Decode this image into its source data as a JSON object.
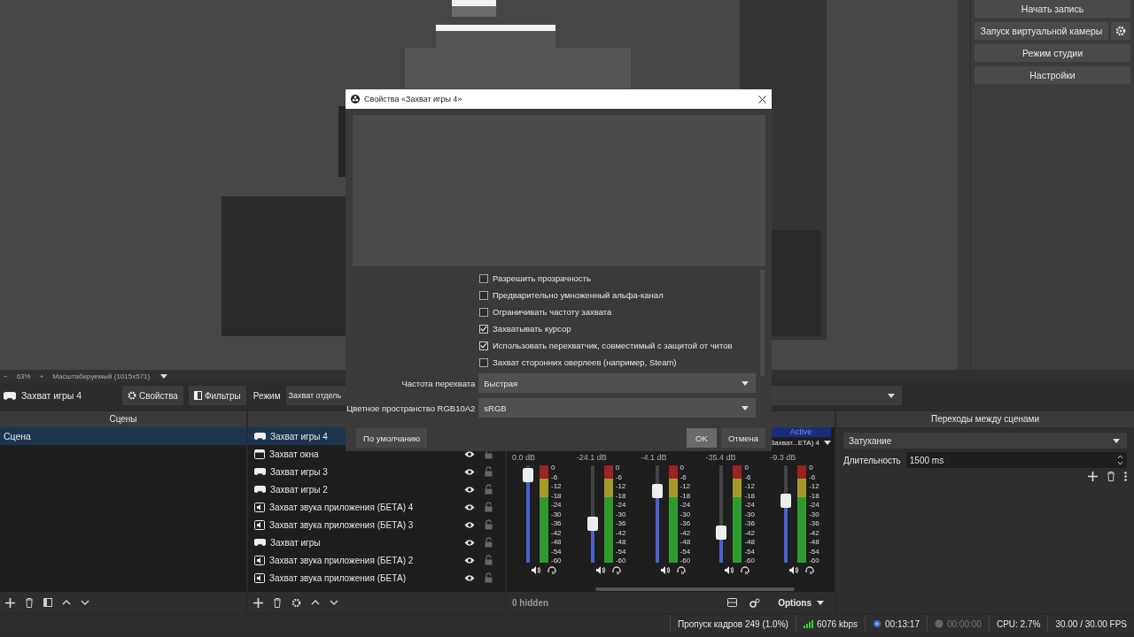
{
  "controls": [
    "Начать запись",
    "Запуск виртуальной камеры",
    "Режим студии",
    "Настройки"
  ],
  "zoom_bar": {
    "minus": "−",
    "zoom": "63%",
    "plus": "+",
    "mode": "Масштабируемый (1015x571)"
  },
  "source_toolbar": {
    "source": "Захват игры 4",
    "properties": "Свойства",
    "filters": "Фильтры",
    "mode_label": "Режим",
    "mode_value": "Захват отдель"
  },
  "scenes": {
    "title": "Сцены",
    "items": [
      {
        "name": "Сцена",
        "selected": true
      }
    ]
  },
  "sources": {
    "items": [
      {
        "name": "Захват игры 4",
        "kind": "game",
        "selected": true
      },
      {
        "name": "Захват окна",
        "kind": "window",
        "selected": false,
        "visible": true,
        "locked": false
      },
      {
        "name": "Захват игры 3",
        "kind": "game",
        "selected": false,
        "visible": true,
        "locked": false
      },
      {
        "name": "Захват игры 2",
        "kind": "game",
        "selected": false,
        "visible": true,
        "locked": false
      },
      {
        "name": "Захват звука приложения (БЕТА) 4",
        "kind": "audio",
        "selected": false,
        "visible": true,
        "locked": false
      },
      {
        "name": "Захват звука приложения (БЕТА) 3",
        "kind": "audio",
        "selected": false,
        "visible": true,
        "locked": false
      },
      {
        "name": "Захват игры",
        "kind": "game",
        "selected": false,
        "visible": true,
        "locked": false
      },
      {
        "name": "Захват звука приложения (БЕТА) 2",
        "kind": "audio",
        "selected": false,
        "visible": true,
        "locked": false
      },
      {
        "name": "Захват звука приложения (БЕТА)",
        "kind": "audio",
        "selected": false,
        "visible": true,
        "locked": false
      }
    ]
  },
  "mixer": {
    "active_badge": "Active",
    "last_name": "Захват...ETA) 4",
    "hidden": "0 hidden",
    "options": "Options",
    "channels": [
      {
        "reading": "0.0 dB",
        "level": 0.97,
        "scale": [
          "0",
          "-6",
          "-12",
          "-18",
          "-24",
          "-30",
          "-36",
          "-42",
          "-48",
          "-54",
          "-60"
        ]
      },
      {
        "reading": "-24.1 dB",
        "level": 0.38,
        "scale": [
          "0",
          "-6",
          "-12",
          "-18",
          "-24",
          "-30",
          "-36",
          "-42",
          "-48",
          "-54",
          "-60"
        ]
      },
      {
        "reading": "-4.1 dB",
        "level": 0.78,
        "scale": [
          "0",
          "-6",
          "-12",
          "-18",
          "-24",
          "-30",
          "-36",
          "-42",
          "-48",
          "-54",
          "-60"
        ]
      },
      {
        "reading": "-35.4 dB",
        "level": 0.28,
        "scale": [
          "0",
          "-6",
          "-12",
          "-18",
          "-24",
          "-30",
          "-36",
          "-42",
          "-48",
          "-54",
          "-60"
        ]
      },
      {
        "reading": "-9.3 dB",
        "level": 0.66,
        "scale": [
          "0",
          "-6",
          "-12",
          "-18",
          "-24",
          "-30",
          "-36",
          "-42",
          "-48",
          "-54",
          "-60"
        ]
      }
    ]
  },
  "transitions": {
    "title": "Переходы между сценами",
    "transition": "Затухание",
    "duration_label": "Длительность",
    "duration": "1500 ms"
  },
  "status_bar": {
    "dropped": "Пропуск кадров 249 (1.0%)",
    "bitrate": "6076 kbps",
    "stream_time": "00:13:17",
    "record_time": "00:00:00",
    "cpu": "CPU: 2.7%",
    "fps": "30.00 / 30.00 FPS"
  },
  "dialog": {
    "title": "Свойства «Захват игры 4»",
    "options": [
      {
        "label": "Разрешить прозрачность",
        "checked": false
      },
      {
        "label": "Предварительно умноженный альфа-канал",
        "checked": false
      },
      {
        "label": "Ограничивать частоту захвата",
        "checked": false
      },
      {
        "label": "Захватывать курсор",
        "checked": true
      },
      {
        "label": "Использовать перехватчик, совместимый с защитой от читов",
        "checked": true
      },
      {
        "label": "Захват сторонних оверлеев (например, Steam)",
        "checked": false
      }
    ],
    "fields": [
      {
        "label": "Частота перехвата",
        "value": "Быстрая"
      },
      {
        "label": "Цветное пространство RGB10A2",
        "value": "sRGB"
      }
    ],
    "defaults": "По умолчанию",
    "ok": "OK",
    "cancel": "Отмена"
  }
}
